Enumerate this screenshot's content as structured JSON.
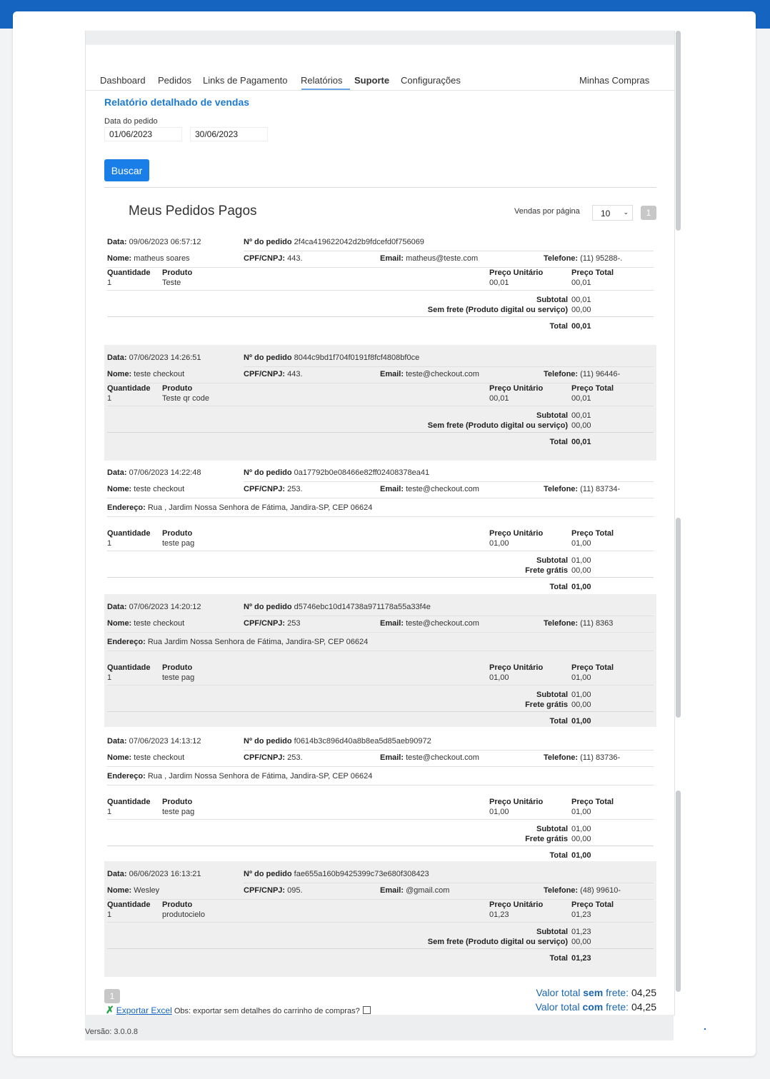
{
  "nav": {
    "dashboard": "Dashboard",
    "pedidos": "Pedidos",
    "links": "Links de Pagamento",
    "relatorios": "Relatórios",
    "suporte": "Suporte",
    "configuracoes": "Configurações",
    "minhas_compras": "Minhas Compras"
  },
  "report": {
    "title": "Relatório detalhado de vendas",
    "date_label": "Data do pedido",
    "date_from": "01/06/2023",
    "date_to": "30/06/2023",
    "search_button": "Buscar"
  },
  "list": {
    "title": "Meus Pedidos Pagos",
    "per_page_label": "Vendas por página",
    "per_page_value": "10",
    "page": "1"
  },
  "labels": {
    "data": "Data:",
    "pedido": "Nº do pedido",
    "nome": "Nome:",
    "cpf": "CPF/CNPJ:",
    "email": "Email:",
    "telefone": "Telefone:",
    "endereco": "Endereço:",
    "quantidade": "Quantidade",
    "produto": "Produto",
    "preco_unitario": "Preço Unitário",
    "preco_total": "Preço Total",
    "subtotal": "Subtotal",
    "total": "Total"
  },
  "orders": [
    {
      "date": "09/06/2023 06:57:12",
      "id": "2f4ca419622042d2b9fdcefd0f756069",
      "name": "matheus soares",
      "cpf": "443.",
      "email": "matheus@teste.com",
      "phone": "(11) 95288-.",
      "address": "",
      "qty": "1",
      "product": "Teste",
      "unit": "00,01",
      "total_price": "00,01",
      "subtotal": "00,01",
      "shipping_label": "Sem frete (Produto digital ou serviço)",
      "shipping": "00,00",
      "total": "00,01"
    },
    {
      "date": "07/06/2023 14:26:51",
      "id": "8044c9bd1f704f0191f8fcf4808bf0ce",
      "name": "teste checkout",
      "cpf": "443.",
      "email": "teste@checkout.com",
      "phone": "(11) 96446-",
      "address": "",
      "qty": "1",
      "product": "Teste qr code",
      "unit": "00,01",
      "total_price": "00,01",
      "subtotal": "00,01",
      "shipping_label": "Sem frete (Produto digital ou serviço)",
      "shipping": "00,00",
      "total": "00,01"
    },
    {
      "date": "07/06/2023 14:22:48",
      "id": "0a17792b0e08466e82ff02408378ea41",
      "name": "teste checkout",
      "cpf": "253.",
      "email": "teste@checkout.com",
      "phone": "(11) 83734-",
      "address": "Rua , Jardim Nossa Senhora de Fátima, Jandira-SP, CEP 06624",
      "qty": "1",
      "product": "teste pag",
      "unit": "01,00",
      "total_price": "01,00",
      "subtotal": "01,00",
      "shipping_label": "Frete grátis",
      "shipping": "00,00",
      "total": "01,00"
    },
    {
      "date": "07/06/2023 14:20:12",
      "id": "d5746ebc10d14738a971178a55a33f4e",
      "name": "teste checkout",
      "cpf": "253",
      "email": "teste@checkout.com",
      "phone": "(11) 8363",
      "address": "Rua Jardim Nossa Senhora de Fátima, Jandira-SP, CEP 06624",
      "qty": "1",
      "product": "teste pag",
      "unit": "01,00",
      "total_price": "01,00",
      "subtotal": "01,00",
      "shipping_label": "Frete grátis",
      "shipping": "00,00",
      "total": "01,00"
    },
    {
      "date": "07/06/2023 14:13:12",
      "id": "f0614b3c896d40a8b8ea5d85aeb90972",
      "name": "teste checkout",
      "cpf": "253.",
      "email": "teste@checkout.com",
      "phone": "(11) 83736-",
      "address": "Rua , Jardim Nossa Senhora de Fátima, Jandira-SP, CEP 06624",
      "qty": "1",
      "product": "teste pag",
      "unit": "01,00",
      "total_price": "01,00",
      "subtotal": "01,00",
      "shipping_label": "Frete grátis",
      "shipping": "00,00",
      "total": "01,00"
    },
    {
      "date": "06/06/2023 16:13:21",
      "id": "fae655a160b9425399c73e680f308423",
      "name": "Wesley",
      "cpf": "095.",
      "email": "@gmail.com",
      "phone": "(48) 99610-",
      "address": "",
      "qty": "1",
      "product": "produtocielo",
      "unit": "01,23",
      "total_price": "01,23",
      "subtotal": "01,23",
      "shipping_label": "Sem frete (Produto digital ou serviço)",
      "shipping": "00,00",
      "total": "01,23"
    }
  ],
  "totals": {
    "prefix": "Valor total",
    "sem": "sem",
    "com": "com",
    "suffix": "frete:",
    "sem_frete_value": "04,25",
    "com_frete_value": "04,25"
  },
  "export": {
    "link": "Exportar Excel",
    "note": "Obs: exportar sem detalhes do carrinho de compras?"
  },
  "version": "Versão: 3.0.0.8",
  "colors": {
    "header_blue": "#1565c0",
    "accent": "#1e7bd1",
    "button": "#1a7ee8",
    "excel_green": "#21a045"
  }
}
